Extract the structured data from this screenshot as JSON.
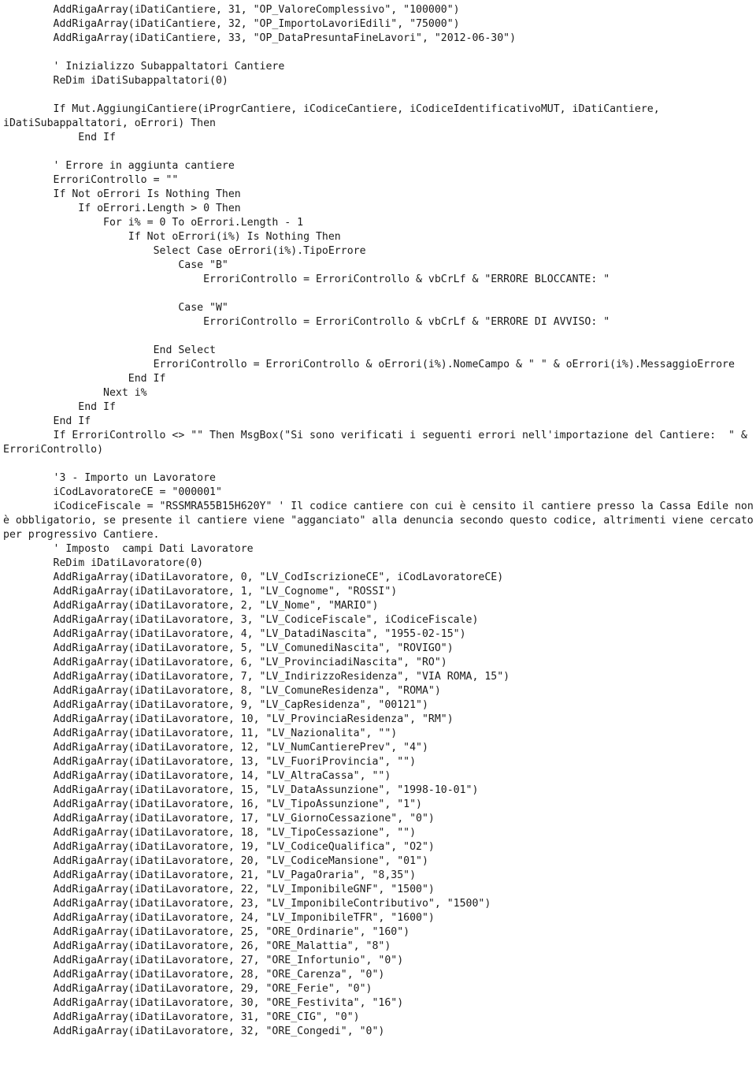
{
  "document": {
    "type": "source-code-listing",
    "language": "VB.NET",
    "background_color": "#ffffff",
    "text_color": "#1a1a1a",
    "lines": [
      "        AddRigaArray(iDatiCantiere, 31, \"OP_ValoreComplessivo\", \"100000\")",
      "        AddRigaArray(iDatiCantiere, 32, \"OP_ImportoLavoriEdili\", \"75000\")",
      "        AddRigaArray(iDatiCantiere, 33, \"OP_DataPresuntaFineLavori\", \"2012-06-30\")",
      "",
      "        ' Inizializzo Subappaltatori Cantiere",
      "        ReDim iDatiSubappaltatori(0)",
      "",
      "        If Mut.AggiungiCantiere(iProgrCantiere, iCodiceCantiere, iCodiceIdentificativoMUT, iDatiCantiere, iDatiSubappaltatori, oErrori) Then",
      "            End If",
      "",
      "        ' Errore in aggiunta cantiere",
      "        ErroriControllo = \"\"",
      "        If Not oErrori Is Nothing Then",
      "            If oErrori.Length > 0 Then",
      "                For i% = 0 To oErrori.Length - 1",
      "                    If Not oErrori(i%) Is Nothing Then",
      "                        Select Case oErrori(i%).TipoErrore",
      "                            Case \"B\"",
      "                                ErroriControllo = ErroriControllo & vbCrLf & \"ERRORE BLOCCANTE: \"",
      "",
      "                            Case \"W\"",
      "                                ErroriControllo = ErroriControllo & vbCrLf & \"ERRORE DI AVVISO: \"",
      "",
      "                        End Select",
      "                        ErroriControllo = ErroriControllo & oErrori(i%).NomeCampo & \" \" & oErrori(i%).MessaggioErrore",
      "                    End If",
      "                Next i%",
      "            End If",
      "        End If",
      "        If ErroriControllo <> \"\" Then MsgBox(\"Si sono verificati i seguenti errori nell'importazione del Cantiere:  \" & ErroriControllo)",
      "",
      "        '3 - Importo un Lavoratore",
      "        iCodLavoratoreCE = \"000001\"",
      "        iCodiceFiscale = \"RSSMRA55B15H620Y\" ' Il codice cantiere con cui è censito il cantiere presso la Cassa Edile non è obbligatorio, se presente il cantiere viene \"agganciato\" alla denuncia secondo questo codice, altrimenti viene cercato per progressivo Cantiere.",
      "        ' Imposto  campi Dati Lavoratore",
      "        ReDim iDatiLavoratore(0)",
      "        AddRigaArray(iDatiLavoratore, 0, \"LV_CodIscrizioneCE\", iCodLavoratoreCE)",
      "        AddRigaArray(iDatiLavoratore, 1, \"LV_Cognome\", \"ROSSI\")",
      "        AddRigaArray(iDatiLavoratore, 2, \"LV_Nome\", \"MARIO\")",
      "        AddRigaArray(iDatiLavoratore, 3, \"LV_CodiceFiscale\", iCodiceFiscale)",
      "        AddRigaArray(iDatiLavoratore, 4, \"LV_DatadiNascita\", \"1955-02-15\")",
      "        AddRigaArray(iDatiLavoratore, 5, \"LV_ComunediNascita\", \"ROVIGO\")",
      "        AddRigaArray(iDatiLavoratore, 6, \"LV_ProvinciadiNascita\", \"RO\")",
      "        AddRigaArray(iDatiLavoratore, 7, \"LV_IndirizzoResidenza\", \"VIA ROMA, 15\")",
      "        AddRigaArray(iDatiLavoratore, 8, \"LV_ComuneResidenza\", \"ROMA\")",
      "        AddRigaArray(iDatiLavoratore, 9, \"LV_CapResidenza\", \"00121\")",
      "        AddRigaArray(iDatiLavoratore, 10, \"LV_ProvinciaResidenza\", \"RM\")",
      "        AddRigaArray(iDatiLavoratore, 11, \"LV_Nazionalita\", \"\")",
      "        AddRigaArray(iDatiLavoratore, 12, \"LV_NumCantierePrev\", \"4\")",
      "        AddRigaArray(iDatiLavoratore, 13, \"LV_FuoriProvincia\", \"\")",
      "        AddRigaArray(iDatiLavoratore, 14, \"LV_AltraCassa\", \"\")",
      "        AddRigaArray(iDatiLavoratore, 15, \"LV_DataAssunzione\", \"1998-10-01\")",
      "        AddRigaArray(iDatiLavoratore, 16, \"LV_TipoAssunzione\", \"1\")",
      "        AddRigaArray(iDatiLavoratore, 17, \"LV_GiornoCessazione\", \"0\")",
      "        AddRigaArray(iDatiLavoratore, 18, \"LV_TipoCessazione\", \"\")",
      "        AddRigaArray(iDatiLavoratore, 19, \"LV_CodiceQualifica\", \"O2\")",
      "        AddRigaArray(iDatiLavoratore, 20, \"LV_CodiceMansione\", \"01\")",
      "        AddRigaArray(iDatiLavoratore, 21, \"LV_PagaOraria\", \"8,35\")",
      "        AddRigaArray(iDatiLavoratore, 22, \"LV_ImponibileGNF\", \"1500\")",
      "        AddRigaArray(iDatiLavoratore, 23, \"LV_ImponibileContributivo\", \"1500\")",
      "        AddRigaArray(iDatiLavoratore, 24, \"LV_ImponibileTFR\", \"1600\")",
      "        AddRigaArray(iDatiLavoratore, 25, \"ORE_Ordinarie\", \"160\")",
      "        AddRigaArray(iDatiLavoratore, 26, \"ORE_Malattia\", \"8\")",
      "        AddRigaArray(iDatiLavoratore, 27, \"ORE_Infortunio\", \"0\")",
      "        AddRigaArray(iDatiLavoratore, 28, \"ORE_Carenza\", \"0\")",
      "        AddRigaArray(iDatiLavoratore, 29, \"ORE_Ferie\", \"0\")",
      "        AddRigaArray(iDatiLavoratore, 30, \"ORE_Festivita\", \"16\")",
      "        AddRigaArray(iDatiLavoratore, 31, \"ORE_CIG\", \"0\")",
      "        AddRigaArray(iDatiLavoratore, 32, \"ORE_Congedi\", \"0\")"
    ]
  }
}
